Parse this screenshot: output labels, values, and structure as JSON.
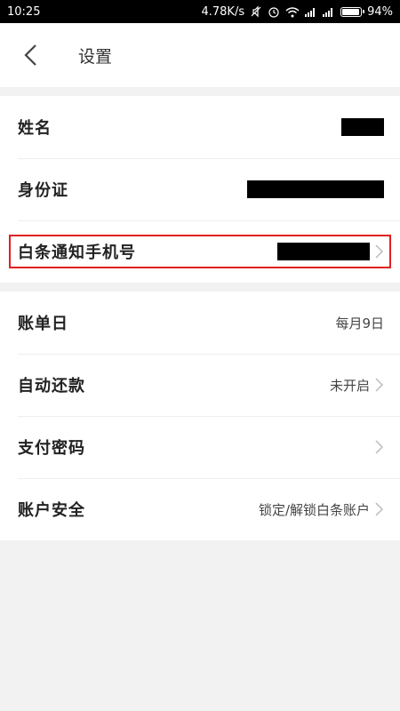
{
  "status_bar": {
    "time": "10:25",
    "net_speed": "4.78K/s",
    "battery_pct": "94%",
    "battery_level": 0.94,
    "icons": [
      "mute-icon",
      "alarm-icon",
      "wifi-icon",
      "signal-icon",
      "signal-icon",
      "battery-icon"
    ]
  },
  "header": {
    "title": "设置",
    "back_icon": "back-icon"
  },
  "identity": {
    "name_label": "姓名",
    "id_label": "身份证",
    "phone_label": "白条通知手机号"
  },
  "settings": {
    "bill_day_label": "账单日",
    "bill_day_value": "每月9日",
    "autopay_label": "自动还款",
    "autopay_value": "未开启",
    "password_label": "支付密码",
    "security_label": "账户安全",
    "security_value": "锁定/解锁白条账户"
  },
  "colors": {
    "highlight": "#e02020",
    "background": "#f2f2f2"
  }
}
